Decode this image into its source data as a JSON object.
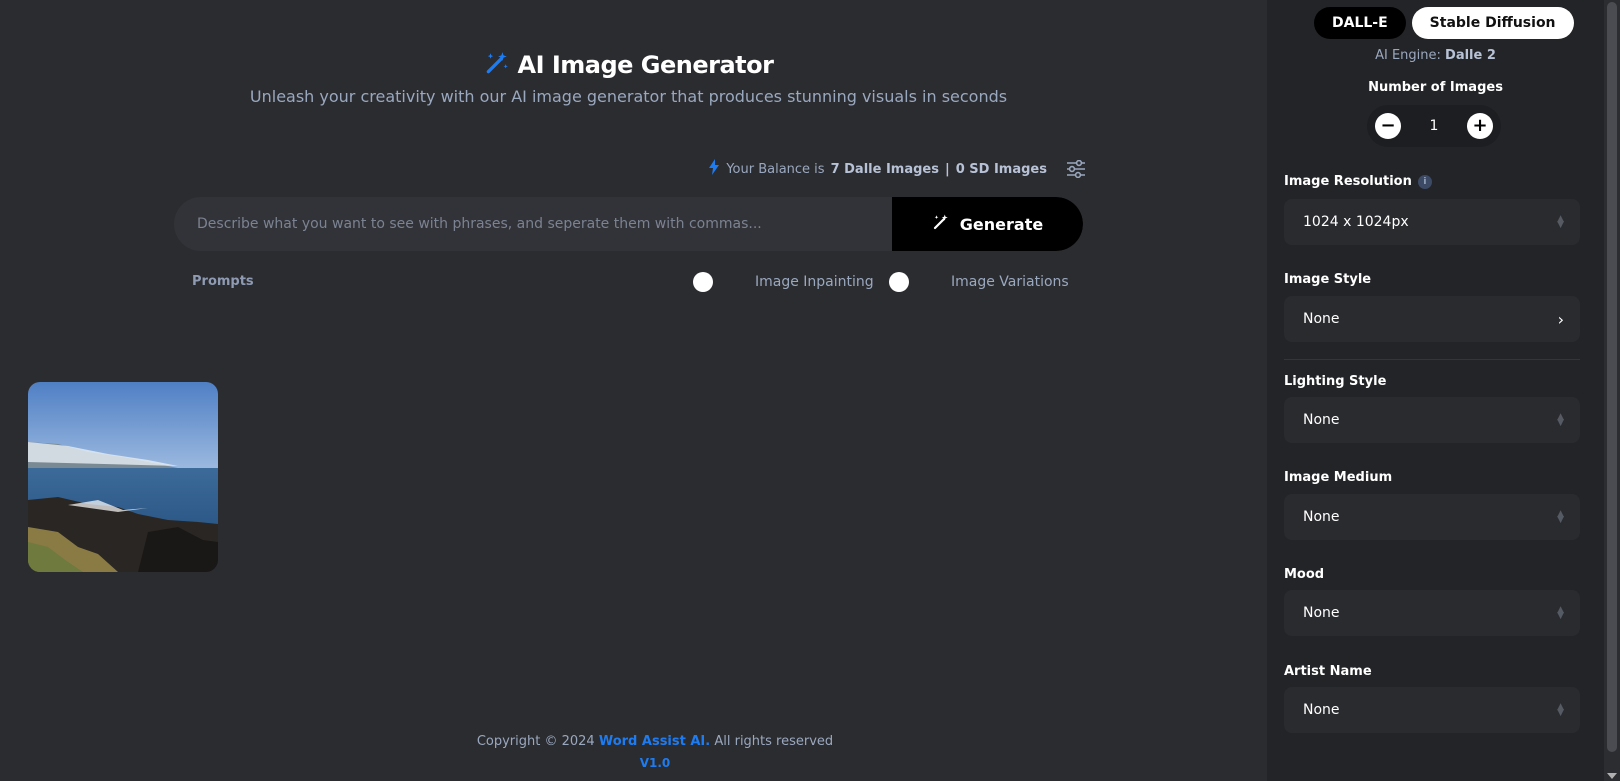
{
  "header": {
    "title": "AI Image Generator",
    "subtitle": "Unleash your creativity with our AI image generator that produces stunning visuals in seconds"
  },
  "balance": {
    "prefix": "Your Balance is",
    "dalle": "7 Dalle Images",
    "separator": "|",
    "sd": "0 SD Images"
  },
  "prompt": {
    "placeholder": "Describe what you want to see with phrases, and seperate them with commas...",
    "value": ""
  },
  "generate_label": "Generate",
  "prompts_label": "Prompts",
  "toggles": {
    "inpainting": "Image Inpainting",
    "variations": "Image Variations"
  },
  "footer": {
    "copyright_prefix": "Copyright © 2024",
    "brand": "Word Assist AI.",
    "suffix": "All rights reserved",
    "version": "V1.0"
  },
  "sidebar": {
    "tabs": [
      "DALL-E",
      "Stable Diffusion"
    ],
    "engine_prefix": "AI Engine:",
    "engine_value": "Dalle 2",
    "num_images_label": "Number of Images",
    "num_images_value": "1",
    "minus": "−",
    "plus": "+",
    "fields": {
      "resolution": {
        "label": "Image Resolution",
        "value": "1024 x 1024px"
      },
      "style": {
        "label": "Image Style",
        "value": "None"
      },
      "lighting": {
        "label": "Lighting Style",
        "value": "None"
      },
      "medium": {
        "label": "Image Medium",
        "value": "None"
      },
      "mood": {
        "label": "Mood",
        "value": "None"
      },
      "artist": {
        "label": "Artist Name",
        "value": "None"
      }
    }
  },
  "colors": {
    "accent": "#1e7cf2",
    "background": "#2b2c30",
    "sidebar": "#232427"
  }
}
